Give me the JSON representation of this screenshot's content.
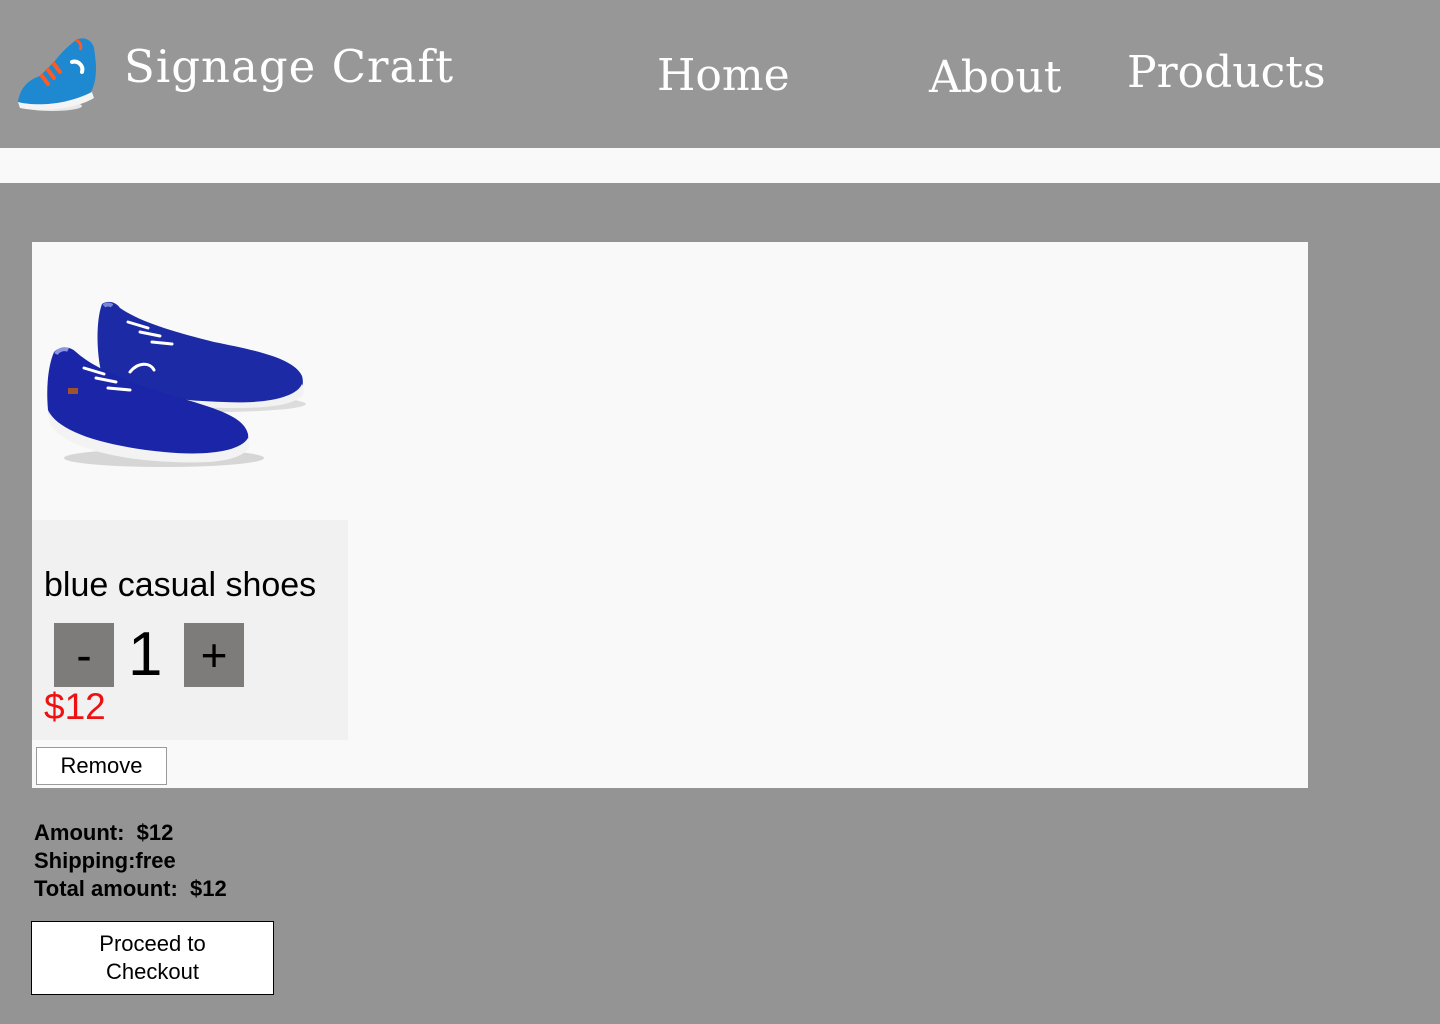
{
  "header": {
    "brand": "Signage Craft",
    "logo_icon": "running-shoe-logo-icon",
    "nav": {
      "home": "Home",
      "about": "About",
      "products": "Products"
    }
  },
  "cart": {
    "item": {
      "name": "blue casual shoes",
      "image_icon": "blue-boat-shoes-image",
      "minus_label": "-",
      "plus_label": "+",
      "quantity": "1",
      "price": "$12",
      "remove_label": "Remove"
    }
  },
  "summary": {
    "amount": "Amount:  $12",
    "shipping": "Shipping:free",
    "total": "Total amount:  $12"
  },
  "checkout": {
    "label": "Proceed to Checkout"
  },
  "colors": {
    "background": "#949494",
    "header": "#979797",
    "panel": "#f9f9f9",
    "card": "#f1f1f1",
    "price": "#ee1111",
    "qty_button": "#7e7b7b"
  }
}
